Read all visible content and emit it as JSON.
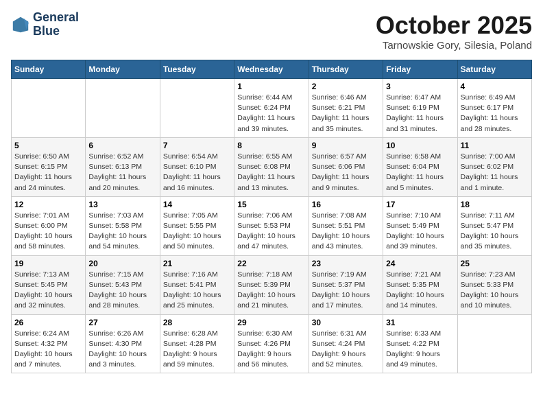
{
  "header": {
    "logo_line1": "General",
    "logo_line2": "Blue",
    "month": "October 2025",
    "location": "Tarnowskie Gory, Silesia, Poland"
  },
  "weekdays": [
    "Sunday",
    "Monday",
    "Tuesday",
    "Wednesday",
    "Thursday",
    "Friday",
    "Saturday"
  ],
  "weeks": [
    [
      {
        "day": "",
        "info": ""
      },
      {
        "day": "",
        "info": ""
      },
      {
        "day": "",
        "info": ""
      },
      {
        "day": "1",
        "info": "Sunrise: 6:44 AM\nSunset: 6:24 PM\nDaylight: 11 hours\nand 39 minutes."
      },
      {
        "day": "2",
        "info": "Sunrise: 6:46 AM\nSunset: 6:21 PM\nDaylight: 11 hours\nand 35 minutes."
      },
      {
        "day": "3",
        "info": "Sunrise: 6:47 AM\nSunset: 6:19 PM\nDaylight: 11 hours\nand 31 minutes."
      },
      {
        "day": "4",
        "info": "Sunrise: 6:49 AM\nSunset: 6:17 PM\nDaylight: 11 hours\nand 28 minutes."
      }
    ],
    [
      {
        "day": "5",
        "info": "Sunrise: 6:50 AM\nSunset: 6:15 PM\nDaylight: 11 hours\nand 24 minutes."
      },
      {
        "day": "6",
        "info": "Sunrise: 6:52 AM\nSunset: 6:13 PM\nDaylight: 11 hours\nand 20 minutes."
      },
      {
        "day": "7",
        "info": "Sunrise: 6:54 AM\nSunset: 6:10 PM\nDaylight: 11 hours\nand 16 minutes."
      },
      {
        "day": "8",
        "info": "Sunrise: 6:55 AM\nSunset: 6:08 PM\nDaylight: 11 hours\nand 13 minutes."
      },
      {
        "day": "9",
        "info": "Sunrise: 6:57 AM\nSunset: 6:06 PM\nDaylight: 11 hours\nand 9 minutes."
      },
      {
        "day": "10",
        "info": "Sunrise: 6:58 AM\nSunset: 6:04 PM\nDaylight: 11 hours\nand 5 minutes."
      },
      {
        "day": "11",
        "info": "Sunrise: 7:00 AM\nSunset: 6:02 PM\nDaylight: 11 hours\nand 1 minute."
      }
    ],
    [
      {
        "day": "12",
        "info": "Sunrise: 7:01 AM\nSunset: 6:00 PM\nDaylight: 10 hours\nand 58 minutes."
      },
      {
        "day": "13",
        "info": "Sunrise: 7:03 AM\nSunset: 5:58 PM\nDaylight: 10 hours\nand 54 minutes."
      },
      {
        "day": "14",
        "info": "Sunrise: 7:05 AM\nSunset: 5:55 PM\nDaylight: 10 hours\nand 50 minutes."
      },
      {
        "day": "15",
        "info": "Sunrise: 7:06 AM\nSunset: 5:53 PM\nDaylight: 10 hours\nand 47 minutes."
      },
      {
        "day": "16",
        "info": "Sunrise: 7:08 AM\nSunset: 5:51 PM\nDaylight: 10 hours\nand 43 minutes."
      },
      {
        "day": "17",
        "info": "Sunrise: 7:10 AM\nSunset: 5:49 PM\nDaylight: 10 hours\nand 39 minutes."
      },
      {
        "day": "18",
        "info": "Sunrise: 7:11 AM\nSunset: 5:47 PM\nDaylight: 10 hours\nand 35 minutes."
      }
    ],
    [
      {
        "day": "19",
        "info": "Sunrise: 7:13 AM\nSunset: 5:45 PM\nDaylight: 10 hours\nand 32 minutes."
      },
      {
        "day": "20",
        "info": "Sunrise: 7:15 AM\nSunset: 5:43 PM\nDaylight: 10 hours\nand 28 minutes."
      },
      {
        "day": "21",
        "info": "Sunrise: 7:16 AM\nSunset: 5:41 PM\nDaylight: 10 hours\nand 25 minutes."
      },
      {
        "day": "22",
        "info": "Sunrise: 7:18 AM\nSunset: 5:39 PM\nDaylight: 10 hours\nand 21 minutes."
      },
      {
        "day": "23",
        "info": "Sunrise: 7:19 AM\nSunset: 5:37 PM\nDaylight: 10 hours\nand 17 minutes."
      },
      {
        "day": "24",
        "info": "Sunrise: 7:21 AM\nSunset: 5:35 PM\nDaylight: 10 hours\nand 14 minutes."
      },
      {
        "day": "25",
        "info": "Sunrise: 7:23 AM\nSunset: 5:33 PM\nDaylight: 10 hours\nand 10 minutes."
      }
    ],
    [
      {
        "day": "26",
        "info": "Sunrise: 6:24 AM\nSunset: 4:32 PM\nDaylight: 10 hours\nand 7 minutes."
      },
      {
        "day": "27",
        "info": "Sunrise: 6:26 AM\nSunset: 4:30 PM\nDaylight: 10 hours\nand 3 minutes."
      },
      {
        "day": "28",
        "info": "Sunrise: 6:28 AM\nSunset: 4:28 PM\nDaylight: 9 hours\nand 59 minutes."
      },
      {
        "day": "29",
        "info": "Sunrise: 6:30 AM\nSunset: 4:26 PM\nDaylight: 9 hours\nand 56 minutes."
      },
      {
        "day": "30",
        "info": "Sunrise: 6:31 AM\nSunset: 4:24 PM\nDaylight: 9 hours\nand 52 minutes."
      },
      {
        "day": "31",
        "info": "Sunrise: 6:33 AM\nSunset: 4:22 PM\nDaylight: 9 hours\nand 49 minutes."
      },
      {
        "day": "",
        "info": ""
      }
    ]
  ]
}
